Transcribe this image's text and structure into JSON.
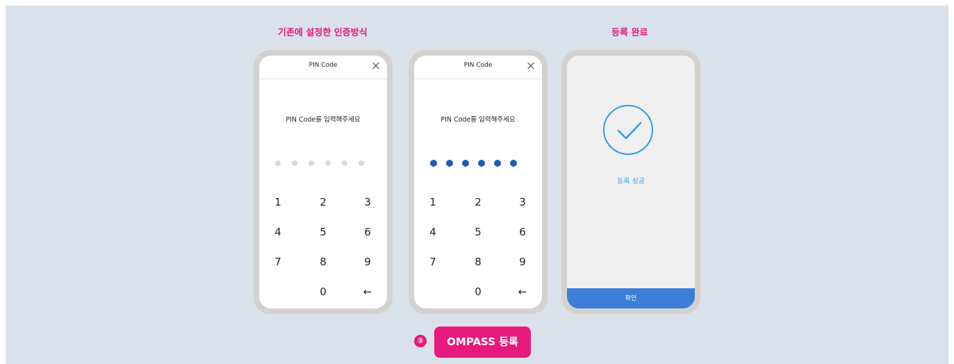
{
  "labels": {
    "existing_method": "기존에 설정한 인증방식",
    "registration_complete": "등록 완료"
  },
  "pin_screen_empty": {
    "title": "PIN Code",
    "close_icon": "×",
    "prompt": "PIN Code를 입력해주세요",
    "pin_length": 6,
    "pin_filled": 0,
    "keys": [
      "1",
      "2",
      "3",
      "4",
      "5",
      "6",
      "7",
      "8",
      "9",
      "0",
      "←"
    ]
  },
  "pin_screen_filled": {
    "title": "PIN Code",
    "close_icon": "×",
    "prompt": "PIN Code를 입력해주세요",
    "pin_length": 6,
    "pin_filled": 6,
    "keys": [
      "1",
      "2",
      "3",
      "4",
      "5",
      "6",
      "7",
      "8",
      "9",
      "0",
      "←"
    ]
  },
  "success_screen": {
    "icon": "check-circle-icon",
    "message": "등록 성공",
    "confirm_label": "확인"
  },
  "step": {
    "number": "③",
    "button_label": "OMPASS 등록"
  },
  "colors": {
    "accent_pink": "#e6197d",
    "pin_dot_filled": "#1a5fb4",
    "success_blue": "#3a9ee6",
    "confirm_button": "#3c7ed8",
    "background": "#dbe1e8"
  }
}
